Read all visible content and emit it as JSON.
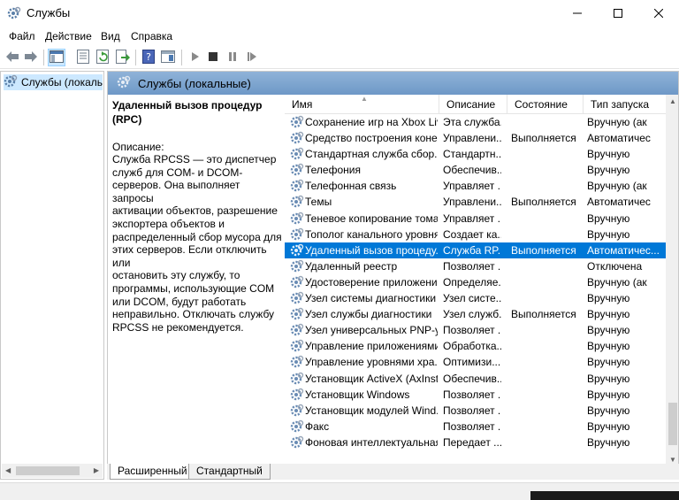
{
  "window": {
    "title": "Службы"
  },
  "menu": [
    "Файл",
    "Действие",
    "Вид",
    "Справка"
  ],
  "tree": {
    "item": "Службы (локальн"
  },
  "pane": {
    "header": "Службы (локальные)"
  },
  "description": {
    "service_name": "Удаленный вызов процедур (RPC)",
    "label": "Описание:",
    "lines": [
      "Служба RPCSS — это диспетчер",
      "служб для COM- и DCOM-",
      "серверов. Она выполняет запросы",
      "активации объектов, разрешение",
      "экспортера объектов и",
      "распределенный сбор мусора для",
      "этих серверов. Если отключить или",
      "остановить эту службу, то",
      "программы, использующие COM",
      "или DCOM, будут работать",
      "неправильно. Отключать службу",
      "RPCSS не рекомендуется."
    ]
  },
  "columns": [
    "Имя",
    "Описание",
    "Состояние",
    "Тип запуска"
  ],
  "services": [
    {
      "name": "Сохранение игр на Xbox Live",
      "desc": "Эта служба...",
      "state": "",
      "start": "Вручную (ак"
    },
    {
      "name": "Средство построения коне...",
      "desc": "Управлени...",
      "state": "Выполняется",
      "start": "Автоматичес"
    },
    {
      "name": "Стандартная служба сбор...",
      "desc": "Стандартн...",
      "state": "",
      "start": "Вручную"
    },
    {
      "name": "Телефония",
      "desc": "Обеспечив...",
      "state": "",
      "start": "Вручную"
    },
    {
      "name": "Телефонная связь",
      "desc": "Управляет ...",
      "state": "",
      "start": "Вручную (ак"
    },
    {
      "name": "Темы",
      "desc": "Управлени...",
      "state": "Выполняется",
      "start": "Автоматичес"
    },
    {
      "name": "Теневое копирование тома",
      "desc": "Управляет ...",
      "state": "",
      "start": "Вручную"
    },
    {
      "name": "Тополог канального уровня",
      "desc": "Создает ка...",
      "state": "",
      "start": "Вручную"
    },
    {
      "name": "Удаленный вызов процеду...",
      "desc": "Служба RP...",
      "state": "Выполняется",
      "start": "Автоматичес...",
      "selected": true
    },
    {
      "name": "Удаленный реестр",
      "desc": "Позволяет ...",
      "state": "",
      "start": "Отключена"
    },
    {
      "name": "Удостоверение приложения",
      "desc": "Определяе...",
      "state": "",
      "start": "Вручную (ак"
    },
    {
      "name": "Узел системы диагностики",
      "desc": "Узел систе...",
      "state": "",
      "start": "Вручную"
    },
    {
      "name": "Узел службы диагностики",
      "desc": "Узел служб...",
      "state": "Выполняется",
      "start": "Вручную"
    },
    {
      "name": "Узел универсальных PNP-у...",
      "desc": "Позволяет ...",
      "state": "",
      "start": "Вручную"
    },
    {
      "name": "Управление приложениями",
      "desc": "Обработка...",
      "state": "",
      "start": "Вручную"
    },
    {
      "name": "Управление уровнями хра...",
      "desc": "Оптимизи...",
      "state": "",
      "start": "Вручную"
    },
    {
      "name": "Установщик ActiveX (AxInst...",
      "desc": "Обеспечив...",
      "state": "",
      "start": "Вручную"
    },
    {
      "name": "Установщик Windows",
      "desc": "Позволяет ...",
      "state": "",
      "start": "Вручную"
    },
    {
      "name": "Установщик модулей Wind...",
      "desc": "Позволяет ...",
      "state": "",
      "start": "Вручную"
    },
    {
      "name": "Факс",
      "desc": "Позволяет ...",
      "state": "",
      "start": "Вручную"
    },
    {
      "name": "Фоновая интеллектуальная...",
      "desc": "Передает ...",
      "state": "",
      "start": "Вручную"
    }
  ],
  "tabs": [
    "Расширенный",
    "Стандартный"
  ],
  "colors": {
    "selection": "#0078d7",
    "header_gradient_top": "#8fb3d8",
    "header_gradient_bottom": "#6e98c7",
    "tree_selection": "#cce8ff"
  },
  "icons": [
    "services-app-icon",
    "back-icon",
    "forward-icon",
    "show-tree-icon",
    "properties-icon",
    "refresh-icon",
    "export-icon",
    "help-icon",
    "view-icon",
    "play-icon",
    "stop-icon",
    "pause-icon",
    "restart-icon",
    "gear-icon"
  ]
}
